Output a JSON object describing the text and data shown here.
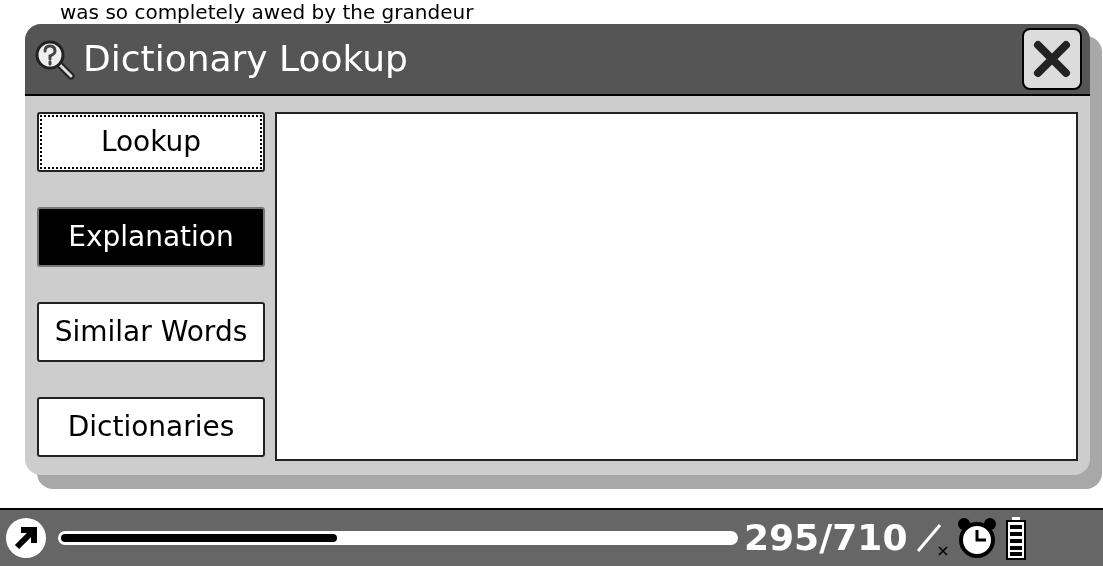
{
  "background_text": "was so completely awed by the grandeur",
  "dialog": {
    "title": "Dictionary Lookup",
    "tabs": [
      {
        "label": "Lookup",
        "selected": false,
        "focused": true
      },
      {
        "label": "Explanation",
        "selected": true,
        "focused": false
      },
      {
        "label": "Similar Words",
        "selected": false,
        "focused": false
      },
      {
        "label": "Dictionaries",
        "selected": false,
        "focused": false
      }
    ]
  },
  "status_bar": {
    "progress": {
      "level": 0.41
    },
    "page": "295/710"
  }
}
